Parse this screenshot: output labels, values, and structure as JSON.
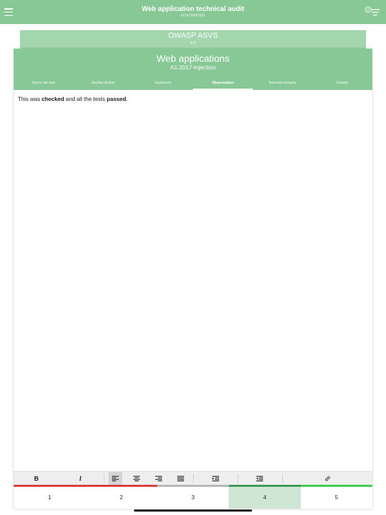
{
  "header": {
    "title": "Web application technical audit",
    "subtitle": "#11476897001",
    "filter_badge": "0"
  },
  "back_card": {
    "title": "OWASP ASVS",
    "version": "4.0"
  },
  "card": {
    "title": "Web applications",
    "subtitle": "A1:2017-Injection",
    "tabs": [
      {
        "label": "Norm std text"
      },
      {
        "label": "Auditor Action"
      },
      {
        "label": "Guidance"
      },
      {
        "label": "Observation",
        "active": true
      },
      {
        "label": "Internal remarks"
      },
      {
        "label": "Details"
      }
    ]
  },
  "editor": {
    "t1": "This was ",
    "b1": "checked",
    "t2": " and all the tests ",
    "b2": "passed",
    "t3": "."
  },
  "toolbar": {
    "bold": "B",
    "italic": "I",
    "selected": "align-left"
  },
  "ratings": {
    "labels": [
      "1",
      "2",
      "3",
      "4",
      "5"
    ],
    "selected": "4",
    "colors": [
      "#e03a3a",
      "#e03a3a",
      "#b8b8b8",
      "#3f9a5a",
      "#3ad14a"
    ]
  }
}
